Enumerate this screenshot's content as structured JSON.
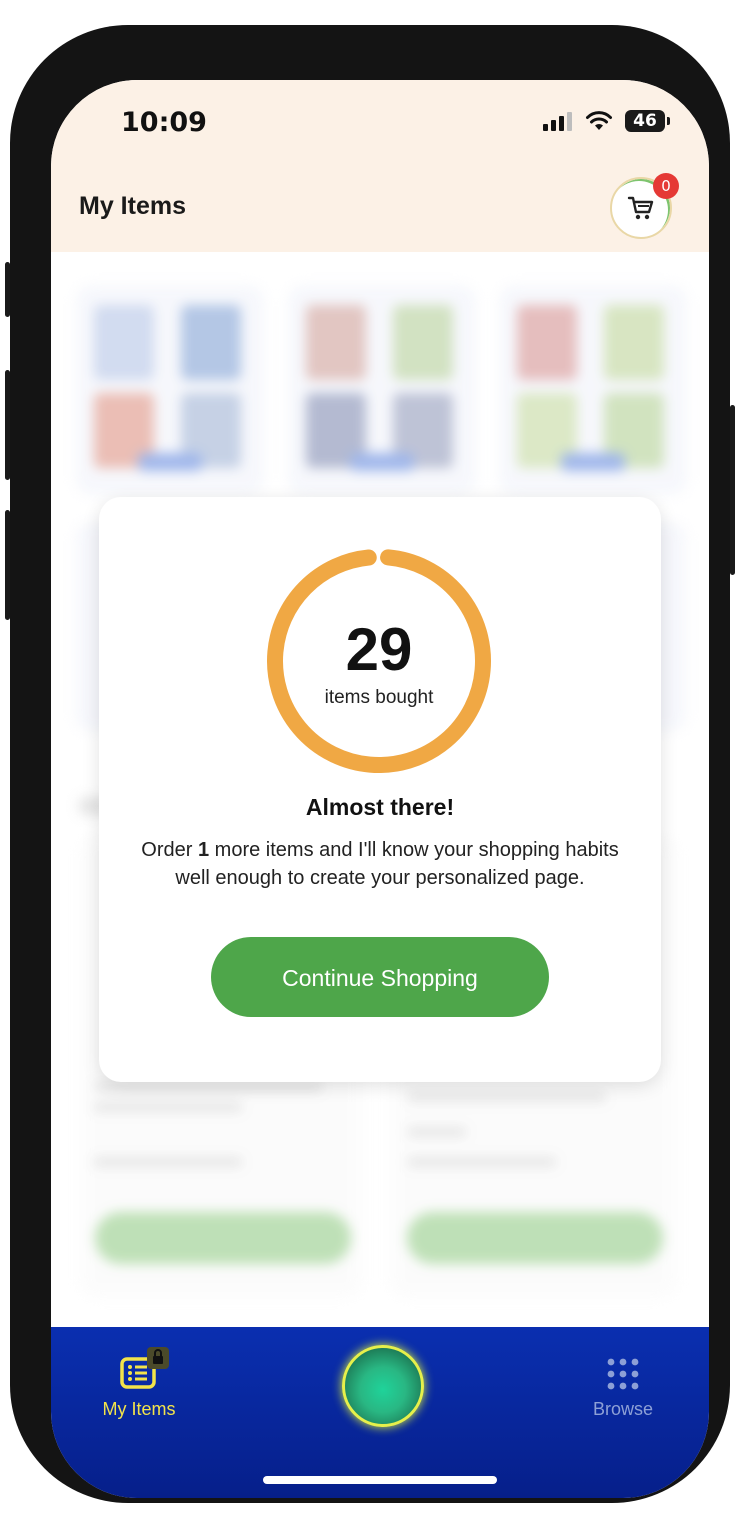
{
  "status_bar": {
    "time": "10:09",
    "battery": "46"
  },
  "header": {
    "title": "My Items",
    "cart_badge_count": "0"
  },
  "modal": {
    "count": "29",
    "count_label": "items bought",
    "progress_fraction": 0.97,
    "ring_color": "#f0a844",
    "headline": "Almost there!",
    "message_prefix": "Order ",
    "message_number": "1",
    "message_suffix": " more items and I'll know your shopping habits well enough to create your personalized page.",
    "cta_label": "Continue Shopping",
    "cta_color": "#4ea64a"
  },
  "bottom_nav": {
    "items": [
      {
        "label": "My Items",
        "icon": "list-lock-icon",
        "active": true
      },
      {
        "label": "Browse",
        "icon": "grid-dots-icon",
        "active": false
      }
    ],
    "center_icon": "assistant-orb-icon"
  }
}
